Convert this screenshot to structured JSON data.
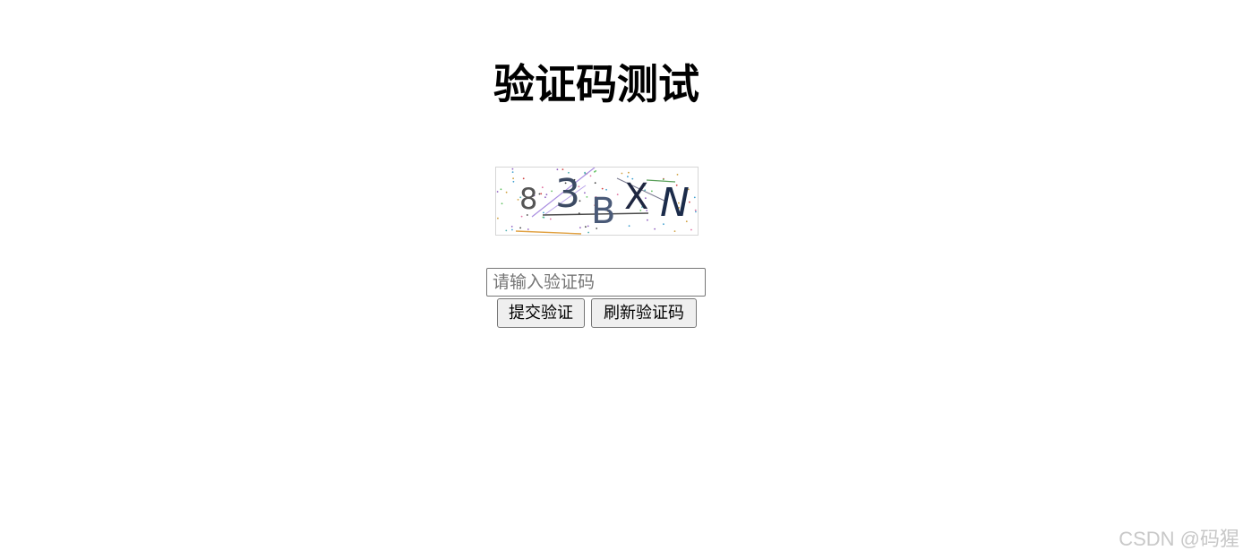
{
  "page": {
    "title": "验证码测试"
  },
  "captcha": {
    "characters": [
      "8",
      "3",
      "B",
      "X",
      "N"
    ],
    "colors": {
      "char_8": "#555555",
      "char_3": "#3c4a63",
      "char_B": "#4a5a78",
      "char_X": "#1e2640",
      "char_N": "#1b2b4a",
      "line_purple": "#a98de0",
      "line_dark": "#4b4b4b",
      "line_green": "#5aa05a",
      "line_orange": "#e0a040"
    }
  },
  "form": {
    "input_placeholder": "请输入验证码",
    "input_value": "",
    "submit_label": "提交验证",
    "refresh_label": "刷新验证码"
  },
  "watermark": {
    "text": "CSDN @码猩"
  }
}
